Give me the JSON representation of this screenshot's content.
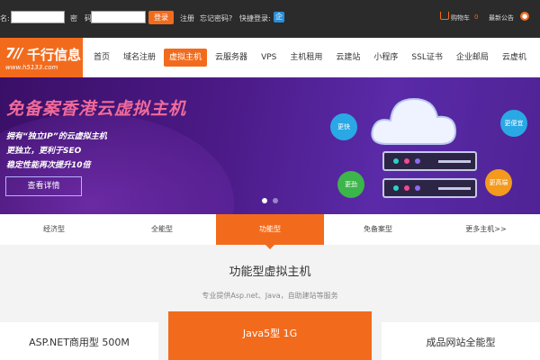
{
  "topbar": {
    "username_label": "名:",
    "password_label": "密　码:",
    "username_value": "",
    "password_value": "",
    "login_label": "登录",
    "register_label": "注册",
    "forgot_label": "忘记密码?",
    "quick_login_label": "快捷登录:",
    "qq_icon_glyph": "企",
    "cart_label": "购物车",
    "cart_count": "0",
    "notice_label": "最新公告"
  },
  "header": {
    "logo_mark": "7//",
    "logo_name": "千行信息",
    "logo_url": "www.h5133.com",
    "nav": [
      {
        "label": "首页",
        "active": false
      },
      {
        "label": "域名注册",
        "active": false
      },
      {
        "label": "虚拟主机",
        "active": true
      },
      {
        "label": "云服务器",
        "active": false
      },
      {
        "label": "VPS",
        "active": false
      },
      {
        "label": "主机租用",
        "active": false
      },
      {
        "label": "云建站",
        "active": false
      },
      {
        "label": "小程序",
        "active": false
      },
      {
        "label": "SSL证书",
        "active": false
      },
      {
        "label": "企业邮局",
        "active": false
      },
      {
        "label": "云虚机",
        "active": false
      }
    ]
  },
  "banner": {
    "title": "免备案香港云虚拟主机",
    "line1": "拥有“独立IP”的云虚拟主机",
    "line2": "更独立，更利于SEO",
    "line3": "稳定性能再次提升10倍",
    "button_label": "查看详情",
    "bubbles": [
      "更快",
      "更便宜",
      "更劲",
      "更高端"
    ],
    "slides_total": 2,
    "slide_active": 1
  },
  "tabs": [
    {
      "label": "经济型",
      "active": false
    },
    {
      "label": "全能型",
      "active": false
    },
    {
      "label": "功能型",
      "active": true
    },
    {
      "label": "免备案型",
      "active": false
    },
    {
      "label": "更多主机>>",
      "active": false
    }
  ],
  "section": {
    "title": "功能型虚拟主机",
    "subtitle": "专业提供Asp.net、Java，自助建站等服务"
  },
  "cards": [
    {
      "label": "ASP.NET商用型 500M"
    },
    {
      "label": "Java5型 1G"
    },
    {
      "label": "成品网站全能型"
    }
  ],
  "colors": {
    "accent": "#f26b1d",
    "topbar": "#2b2b2b",
    "banner": "#4b1a86"
  }
}
